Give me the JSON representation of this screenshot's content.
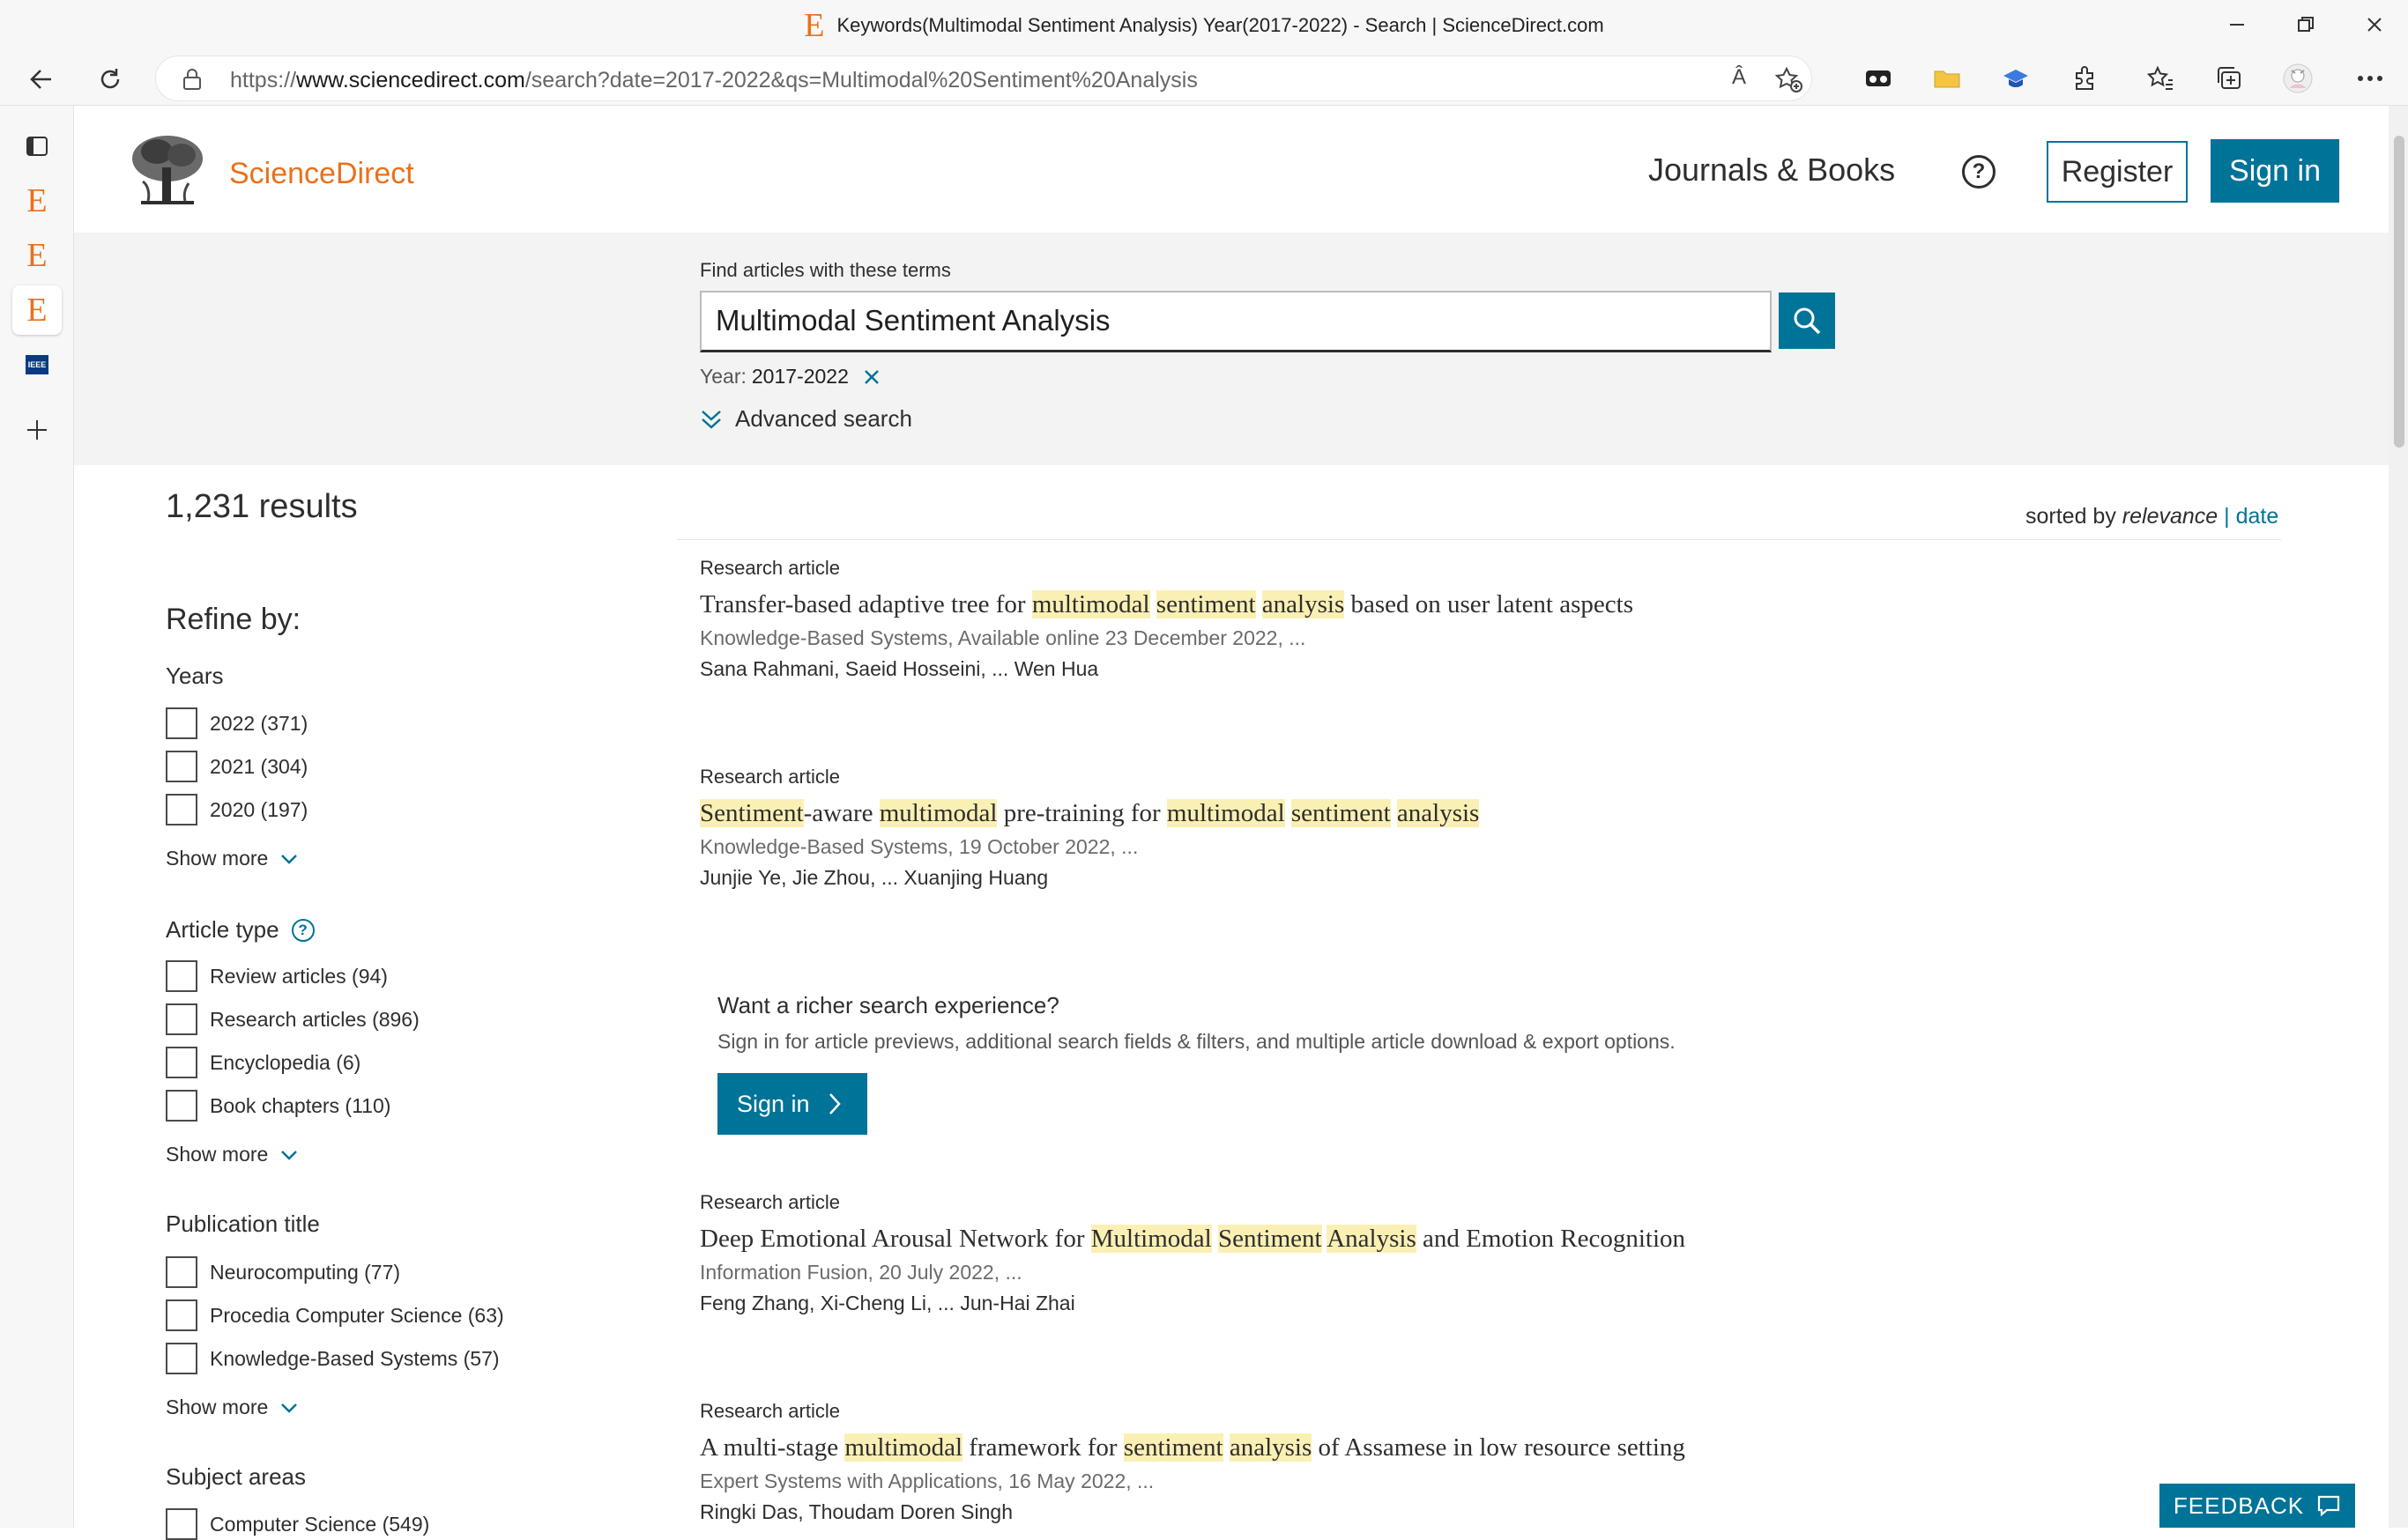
{
  "browser": {
    "tab_title": "Keywords(Multimodal Sentiment Analysis) Year(2017-2022) - Search | ScienceDirect.com",
    "url_scheme": "https://",
    "url_host": "www.sciencedirect.com",
    "url_path": "/search?date=2017-2022&qs=Multimodal%20Sentiment%20Analysis",
    "read_aloud_label": "Â",
    "vertical_tabs": [
      "E",
      "E",
      "E",
      "IEEE"
    ]
  },
  "header": {
    "brand": "ScienceDirect",
    "journals_books": "Journals & Books",
    "help_symbol": "?",
    "register": "Register",
    "sign_in": "Sign in"
  },
  "search": {
    "find_label": "Find articles with these terms",
    "query": "Multimodal Sentiment Analysis",
    "year_label": "Year:",
    "year_value": "2017-2022",
    "advanced": "Advanced search"
  },
  "results": {
    "count": "1,231 results",
    "sorted_by": "sorted by",
    "sort_relevance": "relevance",
    "sort_sep": "|",
    "sort_date": "date"
  },
  "refine": {
    "title": "Refine by:",
    "years_title": "Years",
    "years": [
      "2022 (371)",
      "2021 (304)",
      "2020 (197)"
    ],
    "article_type_title": "Article type",
    "article_types": [
      "Review articles (94)",
      "Research articles (896)",
      "Encyclopedia (6)",
      "Book chapters (110)"
    ],
    "publication_title": "Publication title",
    "publications": [
      "Neurocomputing (77)",
      "Procedia Computer Science (63)",
      "Knowledge-Based Systems (57)"
    ],
    "subject_title": "Subject areas",
    "subjects": [
      "Computer Science (549)"
    ],
    "show_more": "Show more"
  },
  "articles": [
    {
      "type": "Research article",
      "title_parts": [
        "Transfer-based adaptive tree for ",
        "multimodal",
        " ",
        "sentiment",
        " ",
        "analysis",
        " based on user latent aspects"
      ],
      "source": "Knowledge-Based Systems, Available online 23 December 2022, ...",
      "authors": "Sana Rahmani, Saeid Hosseini, ... Wen Hua"
    },
    {
      "type": "Research article",
      "title_parts": [
        "",
        "Sentiment",
        "-aware ",
        "multimodal",
        " pre-training for ",
        "multimodal",
        " ",
        "sentiment",
        " ",
        "analysis",
        ""
      ],
      "source": "Knowledge-Based Systems, 19 October 2022, ...",
      "authors": "Junjie Ye, Jie Zhou, ... Xuanjing Huang"
    },
    {
      "type": "Research article",
      "title_parts": [
        "Deep Emotional Arousal Network for ",
        "Multimodal",
        " ",
        "Sentiment",
        " ",
        "Analysis",
        " and Emotion Recognition"
      ],
      "source": "Information Fusion, 20 July 2022, ...",
      "authors": "Feng Zhang, Xi-Cheng Li, ... Jun-Hai Zhai"
    },
    {
      "type": "Research article",
      "title_parts": [
        "A multi-stage ",
        "multimodal",
        " framework for ",
        "sentiment",
        " ",
        "analysis",
        " of Assamese in low resource setting"
      ],
      "source": "Expert Systems with Applications, 16 May 2022, ...",
      "authors": "Ringki Das, Thoudam Doren Singh"
    }
  ],
  "promo": {
    "title": "Want a richer search experience?",
    "description": "Sign in for article previews, additional search fields & filters, and multiple article download & export options.",
    "button": "Sign in"
  },
  "feedback": "FEEDBACK",
  "colors": {
    "brand_orange": "#e9711c",
    "primary_blue": "#007398",
    "highlight": "#fbf0b4",
    "panel_gray": "#f3f3f3"
  },
  "icons": [
    "back-icon",
    "refresh-icon",
    "lock-icon",
    "read-aloud-icon",
    "add-favorite-icon",
    "extension-icons",
    "favorites-icon",
    "collections-icon",
    "profile-avatar",
    "more-icon",
    "search-icon",
    "close-icon",
    "chevrons-down-icon",
    "chevron-down-icon",
    "chevron-right-icon",
    "chat-icon"
  ]
}
